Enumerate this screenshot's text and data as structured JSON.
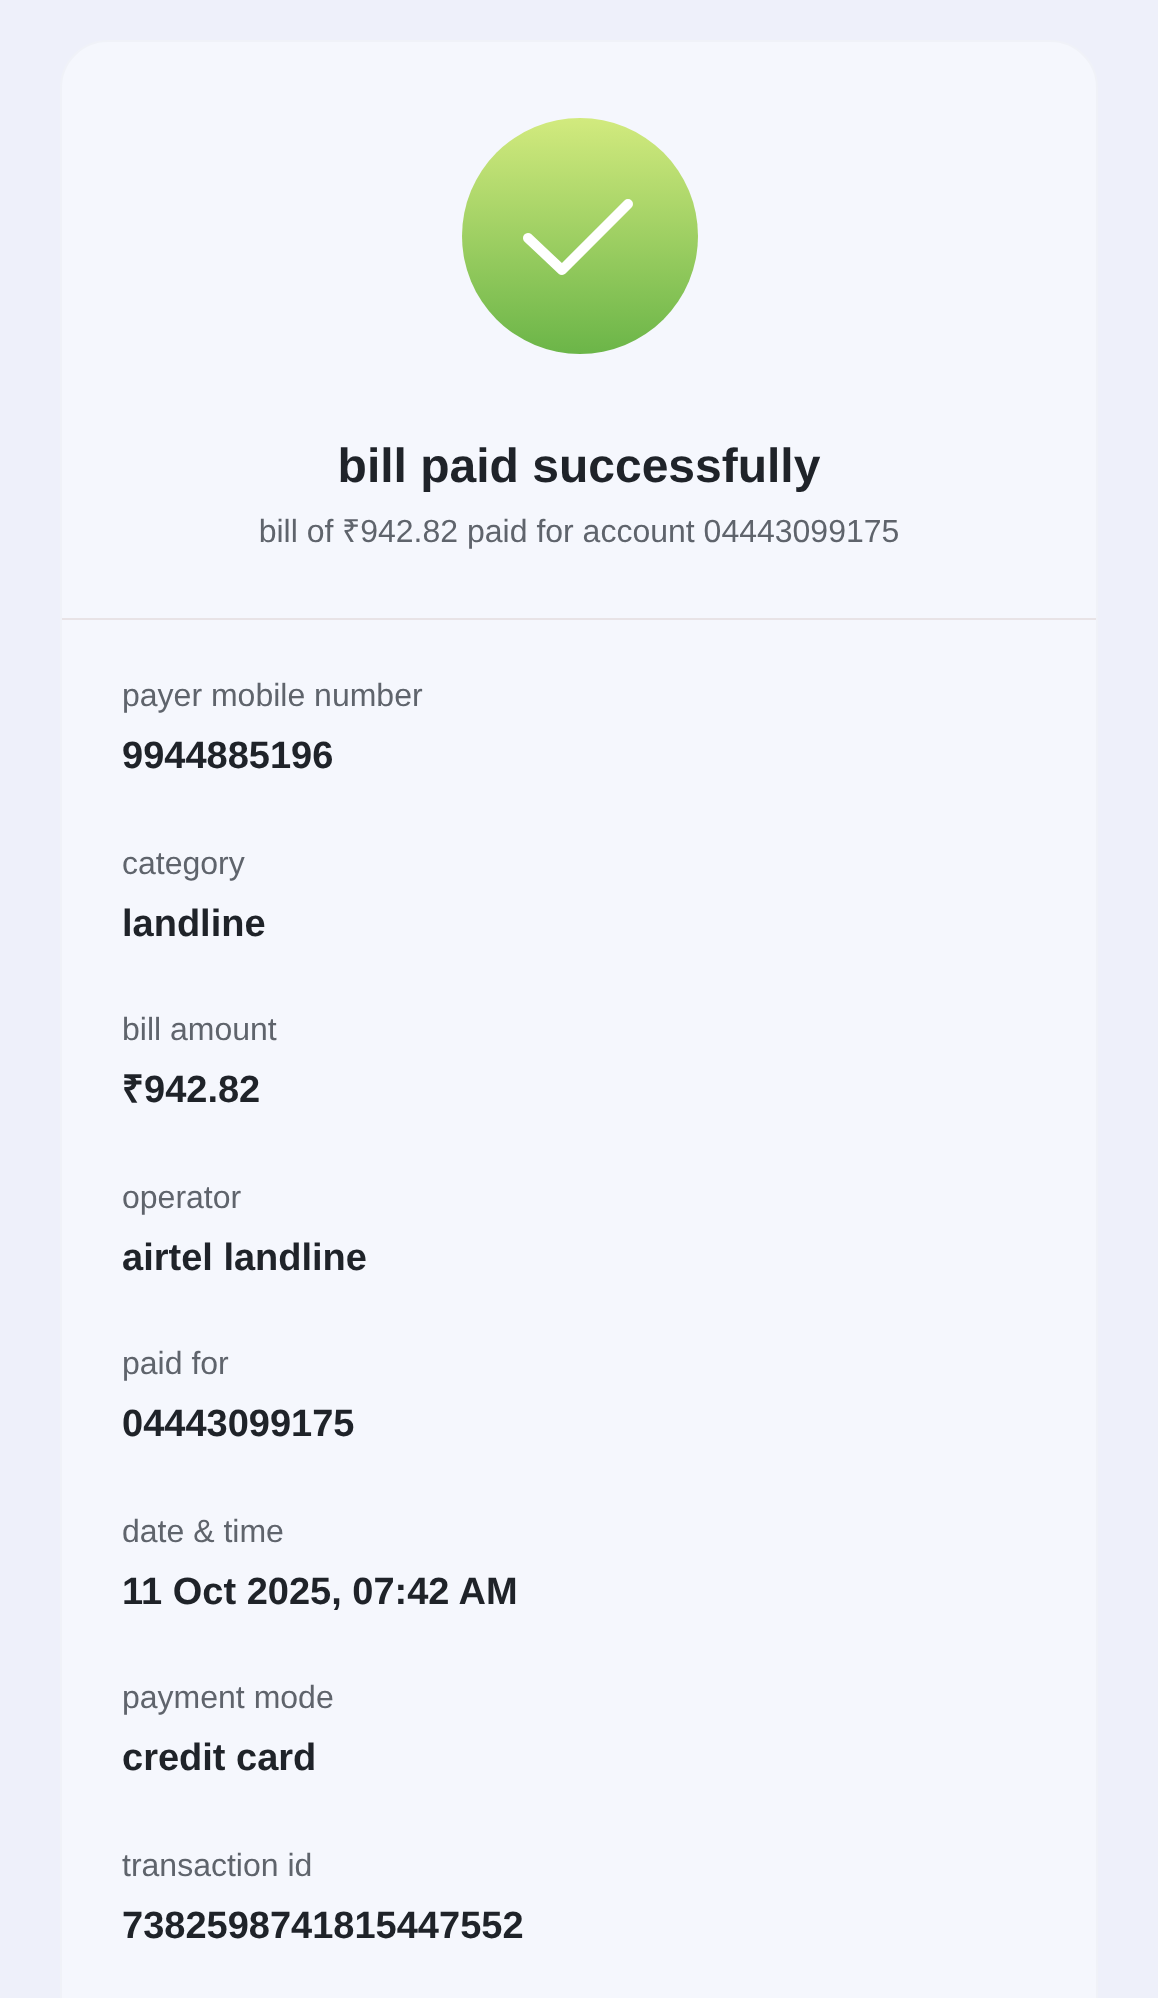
{
  "header": {
    "title": "bill paid successfully",
    "subtitle": "bill of ₹942.82 paid for account 04443099175"
  },
  "details": [
    {
      "label": "payer mobile number",
      "value": "9944885196"
    },
    {
      "label": "category",
      "value": "landline"
    },
    {
      "label": "bill amount",
      "value": "₹942.82"
    },
    {
      "label": "operator",
      "value": "airtel landline"
    },
    {
      "label": "paid for",
      "value": "04443099175"
    },
    {
      "label": "date & time",
      "value": "11 Oct 2025, 07:42 AM"
    },
    {
      "label": "payment mode",
      "value": "credit card"
    },
    {
      "label": "transaction id",
      "value": "7382598741815447552"
    }
  ]
}
